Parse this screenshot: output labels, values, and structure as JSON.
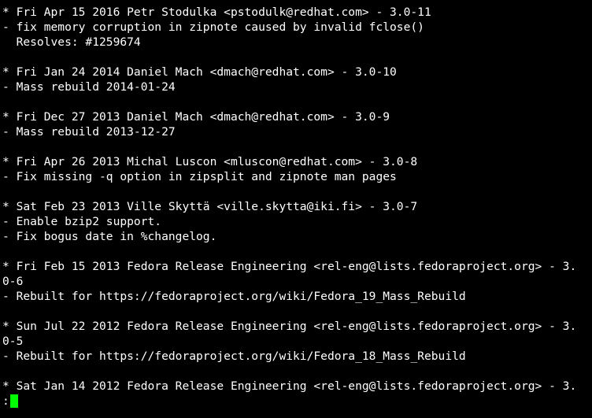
{
  "terminal": {
    "lines": [
      "* Fri Apr 15 2016 Petr Stodulka <pstodulk@redhat.com> - 3.0-11",
      "- fix memory corruption in zipnote caused by invalid fclose()",
      "  Resolves: #1259674",
      "",
      "* Fri Jan 24 2014 Daniel Mach <dmach@redhat.com> - 3.0-10",
      "- Mass rebuild 2014-01-24",
      "",
      "* Fri Dec 27 2013 Daniel Mach <dmach@redhat.com> - 3.0-9",
      "- Mass rebuild 2013-12-27",
      "",
      "* Fri Apr 26 2013 Michal Luscon <mluscon@redhat.com> - 3.0-8",
      "- Fix missing -q option in zipsplit and zipnote man pages",
      "",
      "* Sat Feb 23 2013 Ville Skyttä <ville.skytta@iki.fi> - 3.0-7",
      "- Enable bzip2 support.",
      "- Fix bogus date in %changelog.",
      "",
      "* Fri Feb 15 2013 Fedora Release Engineering <rel-eng@lists.fedoraproject.org> - 3.",
      "0-6",
      "- Rebuilt for https://fedoraproject.org/wiki/Fedora_19_Mass_Rebuild",
      "",
      "* Sun Jul 22 2012 Fedora Release Engineering <rel-eng@lists.fedoraproject.org> - 3.",
      "0-5",
      "- Rebuilt for https://fedoraproject.org/wiki/Fedora_18_Mass_Rebuild",
      "",
      "* Sat Jan 14 2012 Fedora Release Engineering <rel-eng@lists.fedoraproject.org> - 3."
    ],
    "prompt": ":",
    "colors": {
      "background": "#000000",
      "text": "#ffffff",
      "cursor": "#00ff00"
    }
  }
}
